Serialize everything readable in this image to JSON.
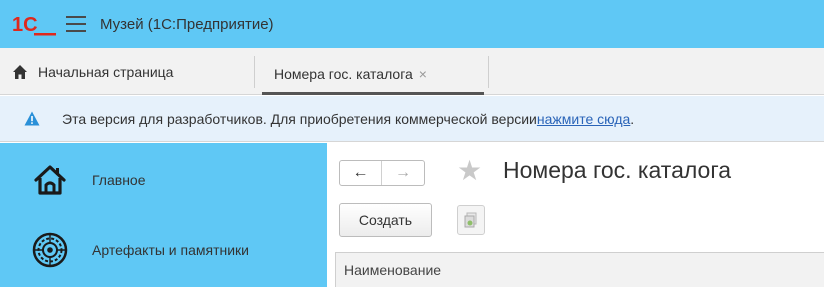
{
  "window": {
    "logo_text": "1С",
    "title": "Музей  (1С:Предприятие)"
  },
  "tabs": {
    "home_label": "Начальная страница",
    "active_label": "Номера гос. каталога",
    "close_symbol": "×"
  },
  "infobar": {
    "text": "Эта версия для разработчиков. Для приобретения коммерческой версии ",
    "link_text": "нажмите сюда",
    "trailing": "."
  },
  "sidebar": {
    "items": [
      {
        "label": "Главное",
        "icon": "home-icon"
      },
      {
        "label": "Артефакты и памятники",
        "icon": "artifacts-icon"
      }
    ]
  },
  "form": {
    "back_symbol": "←",
    "forward_symbol": "→",
    "favorite_symbol": "★",
    "title": "Номера гос. каталога",
    "create_label": "Создать",
    "columns": [
      "Наименование"
    ]
  },
  "colors": {
    "accent": "#5fc8f5",
    "infobar_bg": "#e6f1fb",
    "link": "#2a64b8",
    "logo": "#e0281c"
  }
}
